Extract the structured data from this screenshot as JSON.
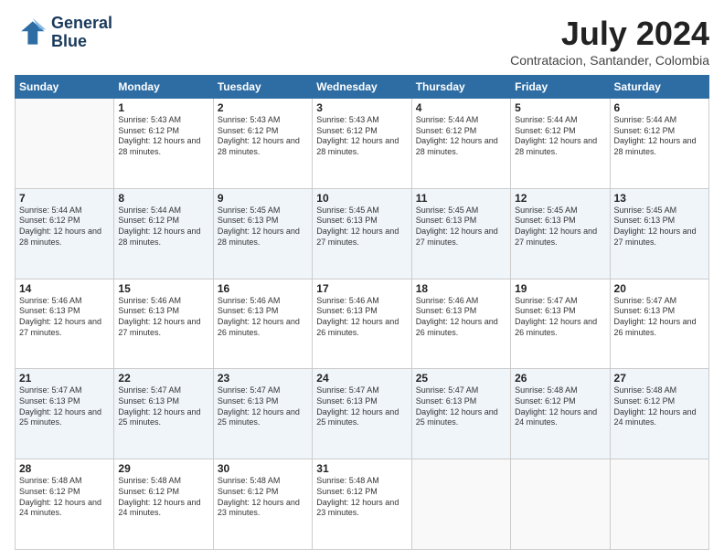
{
  "logo": {
    "line1": "General",
    "line2": "Blue"
  },
  "header": {
    "month_year": "July 2024",
    "location": "Contratacion, Santander, Colombia"
  },
  "weekdays": [
    "Sunday",
    "Monday",
    "Tuesday",
    "Wednesday",
    "Thursday",
    "Friday",
    "Saturday"
  ],
  "weeks": [
    [
      {
        "day": "",
        "sunrise": "",
        "sunset": "",
        "daylight": ""
      },
      {
        "day": "1",
        "sunrise": "Sunrise: 5:43 AM",
        "sunset": "Sunset: 6:12 PM",
        "daylight": "Daylight: 12 hours and 28 minutes."
      },
      {
        "day": "2",
        "sunrise": "Sunrise: 5:43 AM",
        "sunset": "Sunset: 6:12 PM",
        "daylight": "Daylight: 12 hours and 28 minutes."
      },
      {
        "day": "3",
        "sunrise": "Sunrise: 5:43 AM",
        "sunset": "Sunset: 6:12 PM",
        "daylight": "Daylight: 12 hours and 28 minutes."
      },
      {
        "day": "4",
        "sunrise": "Sunrise: 5:44 AM",
        "sunset": "Sunset: 6:12 PM",
        "daylight": "Daylight: 12 hours and 28 minutes."
      },
      {
        "day": "5",
        "sunrise": "Sunrise: 5:44 AM",
        "sunset": "Sunset: 6:12 PM",
        "daylight": "Daylight: 12 hours and 28 minutes."
      },
      {
        "day": "6",
        "sunrise": "Sunrise: 5:44 AM",
        "sunset": "Sunset: 6:12 PM",
        "daylight": "Daylight: 12 hours and 28 minutes."
      }
    ],
    [
      {
        "day": "7",
        "sunrise": "Sunrise: 5:44 AM",
        "sunset": "Sunset: 6:12 PM",
        "daylight": "Daylight: 12 hours and 28 minutes."
      },
      {
        "day": "8",
        "sunrise": "Sunrise: 5:44 AM",
        "sunset": "Sunset: 6:12 PM",
        "daylight": "Daylight: 12 hours and 28 minutes."
      },
      {
        "day": "9",
        "sunrise": "Sunrise: 5:45 AM",
        "sunset": "Sunset: 6:13 PM",
        "daylight": "Daylight: 12 hours and 28 minutes."
      },
      {
        "day": "10",
        "sunrise": "Sunrise: 5:45 AM",
        "sunset": "Sunset: 6:13 PM",
        "daylight": "Daylight: 12 hours and 27 minutes."
      },
      {
        "day": "11",
        "sunrise": "Sunrise: 5:45 AM",
        "sunset": "Sunset: 6:13 PM",
        "daylight": "Daylight: 12 hours and 27 minutes."
      },
      {
        "day": "12",
        "sunrise": "Sunrise: 5:45 AM",
        "sunset": "Sunset: 6:13 PM",
        "daylight": "Daylight: 12 hours and 27 minutes."
      },
      {
        "day": "13",
        "sunrise": "Sunrise: 5:45 AM",
        "sunset": "Sunset: 6:13 PM",
        "daylight": "Daylight: 12 hours and 27 minutes."
      }
    ],
    [
      {
        "day": "14",
        "sunrise": "Sunrise: 5:46 AM",
        "sunset": "Sunset: 6:13 PM",
        "daylight": "Daylight: 12 hours and 27 minutes."
      },
      {
        "day": "15",
        "sunrise": "Sunrise: 5:46 AM",
        "sunset": "Sunset: 6:13 PM",
        "daylight": "Daylight: 12 hours and 27 minutes."
      },
      {
        "day": "16",
        "sunrise": "Sunrise: 5:46 AM",
        "sunset": "Sunset: 6:13 PM",
        "daylight": "Daylight: 12 hours and 26 minutes."
      },
      {
        "day": "17",
        "sunrise": "Sunrise: 5:46 AM",
        "sunset": "Sunset: 6:13 PM",
        "daylight": "Daylight: 12 hours and 26 minutes."
      },
      {
        "day": "18",
        "sunrise": "Sunrise: 5:46 AM",
        "sunset": "Sunset: 6:13 PM",
        "daylight": "Daylight: 12 hours and 26 minutes."
      },
      {
        "day": "19",
        "sunrise": "Sunrise: 5:47 AM",
        "sunset": "Sunset: 6:13 PM",
        "daylight": "Daylight: 12 hours and 26 minutes."
      },
      {
        "day": "20",
        "sunrise": "Sunrise: 5:47 AM",
        "sunset": "Sunset: 6:13 PM",
        "daylight": "Daylight: 12 hours and 26 minutes."
      }
    ],
    [
      {
        "day": "21",
        "sunrise": "Sunrise: 5:47 AM",
        "sunset": "Sunset: 6:13 PM",
        "daylight": "Daylight: 12 hours and 25 minutes."
      },
      {
        "day": "22",
        "sunrise": "Sunrise: 5:47 AM",
        "sunset": "Sunset: 6:13 PM",
        "daylight": "Daylight: 12 hours and 25 minutes."
      },
      {
        "day": "23",
        "sunrise": "Sunrise: 5:47 AM",
        "sunset": "Sunset: 6:13 PM",
        "daylight": "Daylight: 12 hours and 25 minutes."
      },
      {
        "day": "24",
        "sunrise": "Sunrise: 5:47 AM",
        "sunset": "Sunset: 6:13 PM",
        "daylight": "Daylight: 12 hours and 25 minutes."
      },
      {
        "day": "25",
        "sunrise": "Sunrise: 5:47 AM",
        "sunset": "Sunset: 6:13 PM",
        "daylight": "Daylight: 12 hours and 25 minutes."
      },
      {
        "day": "26",
        "sunrise": "Sunrise: 5:48 AM",
        "sunset": "Sunset: 6:12 PM",
        "daylight": "Daylight: 12 hours and 24 minutes."
      },
      {
        "day": "27",
        "sunrise": "Sunrise: 5:48 AM",
        "sunset": "Sunset: 6:12 PM",
        "daylight": "Daylight: 12 hours and 24 minutes."
      }
    ],
    [
      {
        "day": "28",
        "sunrise": "Sunrise: 5:48 AM",
        "sunset": "Sunset: 6:12 PM",
        "daylight": "Daylight: 12 hours and 24 minutes."
      },
      {
        "day": "29",
        "sunrise": "Sunrise: 5:48 AM",
        "sunset": "Sunset: 6:12 PM",
        "daylight": "Daylight: 12 hours and 24 minutes."
      },
      {
        "day": "30",
        "sunrise": "Sunrise: 5:48 AM",
        "sunset": "Sunset: 6:12 PM",
        "daylight": "Daylight: 12 hours and 23 minutes."
      },
      {
        "day": "31",
        "sunrise": "Sunrise: 5:48 AM",
        "sunset": "Sunset: 6:12 PM",
        "daylight": "Daylight: 12 hours and 23 minutes."
      },
      {
        "day": "",
        "sunrise": "",
        "sunset": "",
        "daylight": ""
      },
      {
        "day": "",
        "sunrise": "",
        "sunset": "",
        "daylight": ""
      },
      {
        "day": "",
        "sunrise": "",
        "sunset": "",
        "daylight": ""
      }
    ]
  ]
}
